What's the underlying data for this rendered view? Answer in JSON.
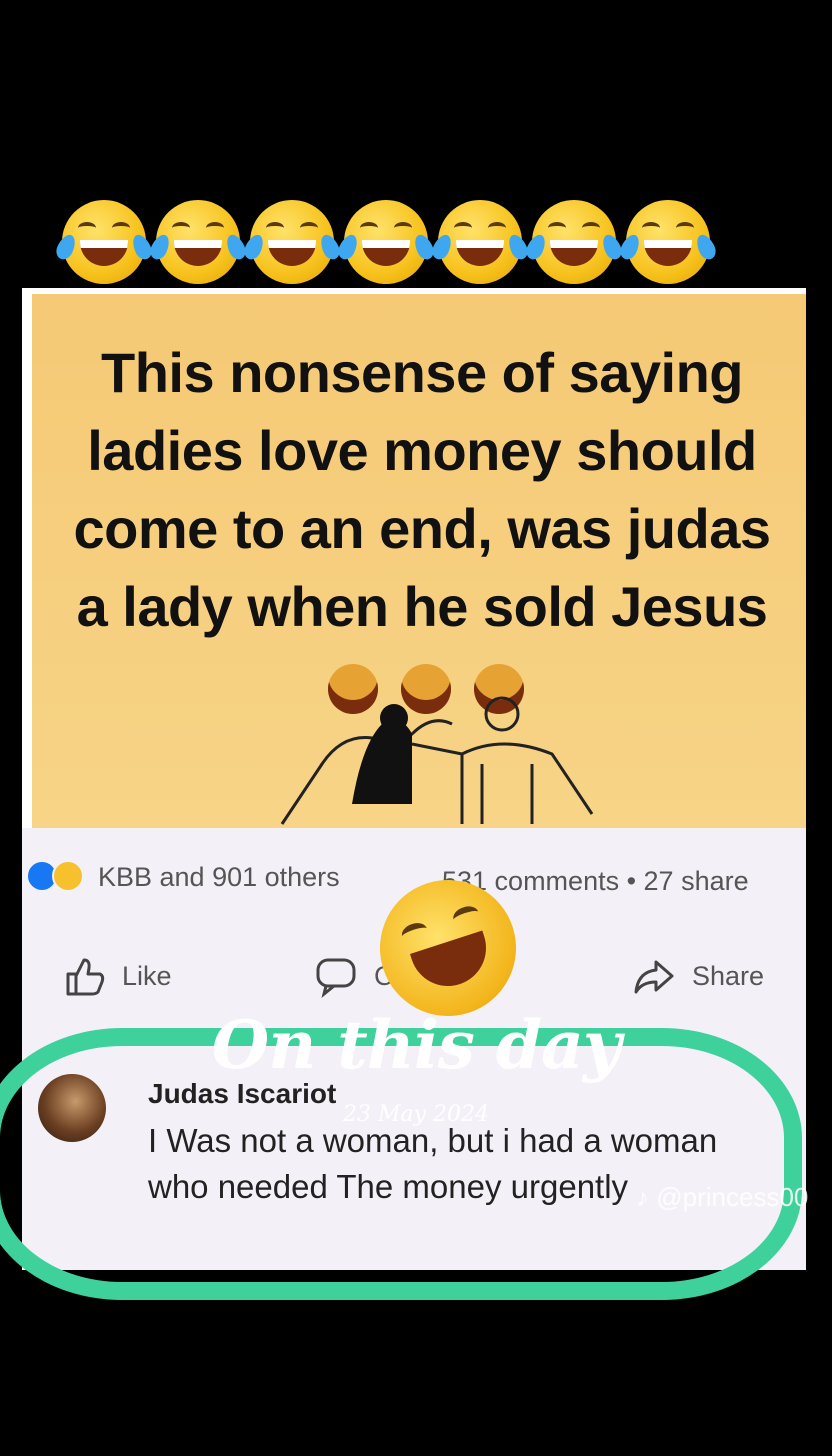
{
  "top_emojis": [
    "laugh-tears",
    "laugh-tears",
    "laugh-tears",
    "laugh-tears",
    "laugh-tears",
    "laugh-tears",
    "laugh-tears"
  ],
  "post": {
    "headline": "This nonsense of saying ladies love money should come to an end, was judas a lady when he sold Jesus",
    "reactions": "KBB and 901 others",
    "comments": "531 comments • 27 share",
    "actions": {
      "like": "Like",
      "comment": "C",
      "share": "Share"
    },
    "comment": {
      "author": "Judas Iscariot",
      "text": "I Was not a woman, but i had a woman who needed The money urgently"
    }
  },
  "overlay": {
    "title": "On this day",
    "date": "23 May 2024",
    "watermark": "@princess00"
  },
  "colors": {
    "card_yellow": "#f5c975",
    "highlight_green": "#3fd19b",
    "background": "#000000"
  }
}
